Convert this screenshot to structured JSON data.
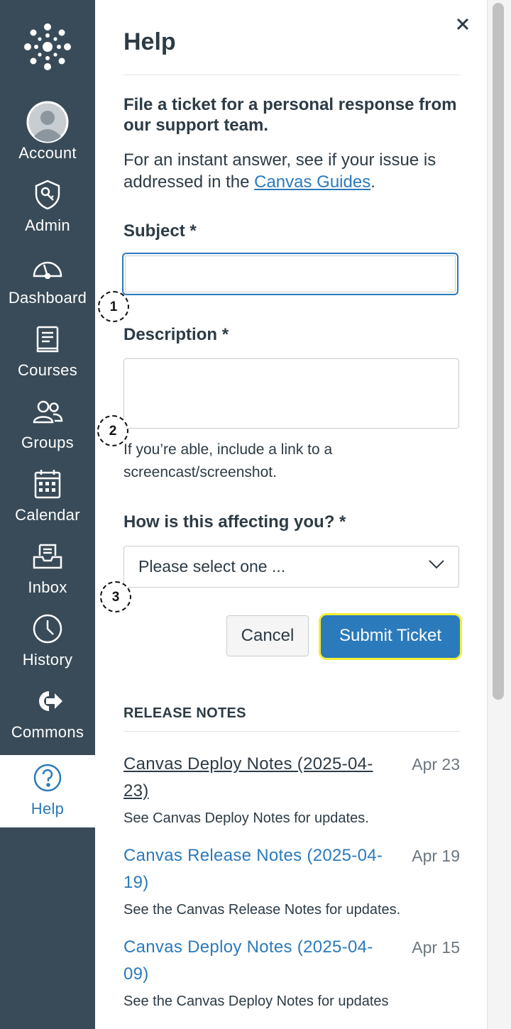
{
  "nav": {
    "items": [
      {
        "label": "Account",
        "icon": "avatar-icon"
      },
      {
        "label": "Admin",
        "icon": "shield-icon"
      },
      {
        "label": "Dashboard",
        "icon": "dashboard-icon"
      },
      {
        "label": "Courses",
        "icon": "book-icon"
      },
      {
        "label": "Groups",
        "icon": "groups-icon"
      },
      {
        "label": "Calendar",
        "icon": "calendar-icon"
      },
      {
        "label": "Inbox",
        "icon": "inbox-icon"
      },
      {
        "label": "History",
        "icon": "clock-icon"
      },
      {
        "label": "Commons",
        "icon": "commons-icon"
      },
      {
        "label": "Help",
        "icon": "question-icon",
        "active": true
      }
    ]
  },
  "tray": {
    "title": "Help",
    "lead": "File a ticket for a personal response from our support team.",
    "instant_prefix": "For an instant answer, see if your issue is addressed in the ",
    "instant_link": "Canvas Guides",
    "instant_suffix": ".",
    "subject_label": "Subject *",
    "subject_value": "",
    "description_label": "Description *",
    "description_hint": "If you’re able, include a link to a screencast/screenshot.",
    "affecting_label": "How is this affecting you? *",
    "affecting_selected": "Please select one ...",
    "cancel_label": "Cancel",
    "submit_label": "Submit Ticket"
  },
  "release_notes": {
    "heading": "RELEASE NOTES",
    "items": [
      {
        "title": "Canvas Deploy Notes (2025-04-23)",
        "date": "Apr 23",
        "desc": "See Canvas Deploy Notes for updates.",
        "visited": true
      },
      {
        "title": "Canvas Release Notes (2025-04-19)",
        "date": "Apr 19",
        "desc": "See the Canvas Release Notes for updates.",
        "visited": false
      },
      {
        "title": "Canvas Deploy Notes (2025-04-09)",
        "date": "Apr 15",
        "desc": "See the Canvas Deploy Notes for updates",
        "visited": false
      }
    ]
  },
  "callouts": [
    "1",
    "2",
    "3"
  ],
  "colors": {
    "nav_bg": "#394b58",
    "link": "#2b7abc",
    "highlight": "#f2ef36"
  }
}
